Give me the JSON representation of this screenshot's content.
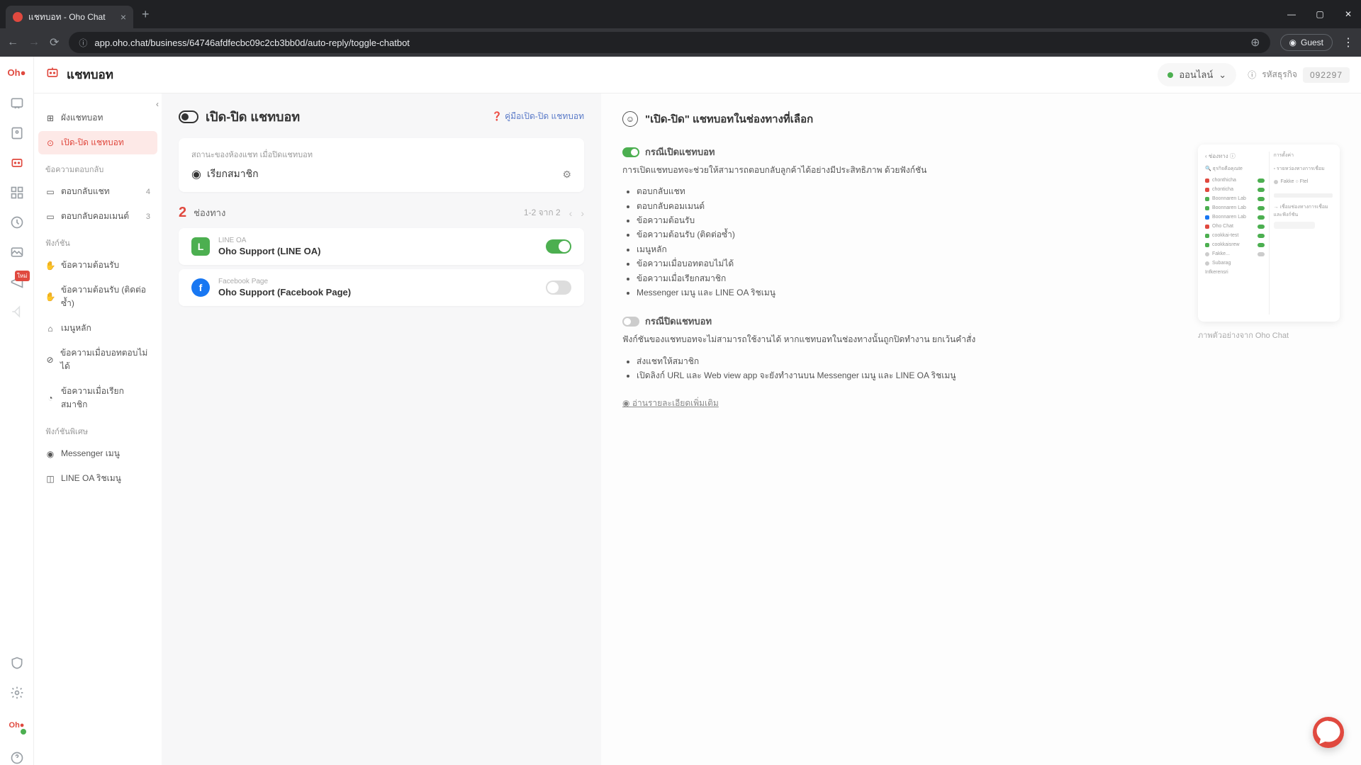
{
  "browser": {
    "tab_title": "แชทบอท - Oho Chat",
    "url": "app.oho.chat/business/64746afdfecbc09c2cb3bb0d/auto-reply/toggle-chatbot",
    "guest_label": "Guest"
  },
  "header": {
    "title": "แชทบอท",
    "status_label": "ออนไลน์",
    "biz_id_label": "รหัสธุรกิจ",
    "biz_id_value": "092297"
  },
  "sidebar": {
    "items_top": [
      {
        "label": "ผังแชทบอท",
        "icon": "flow"
      }
    ],
    "active": {
      "label": "เปิด-ปิด แชทบอท",
      "icon": "toggle"
    },
    "section_auto_reply": "ข้อความตอบกลับ",
    "items_auto": [
      {
        "label": "ตอบกลับแชท",
        "badge": "4"
      },
      {
        "label": "ตอบกลับคอมเมนต์",
        "badge": "3"
      }
    ],
    "section_func": "ฟังก์ชัน",
    "items_func": [
      {
        "label": "ข้อความต้อนรับ"
      },
      {
        "label": "ข้อความต้อนรับ (ติดต่อซ้ำ)"
      },
      {
        "label": "เมนูหลัก"
      },
      {
        "label": "ข้อความเมื่อบอทตอบไม่ได้"
      },
      {
        "label": "ข้อความเมื่อเรียกสมาชิก"
      }
    ],
    "section_special": "ฟังก์ชันพิเศษ",
    "items_special": [
      {
        "label": "Messenger เมนู"
      },
      {
        "label": "LINE OA ริชเมนู"
      }
    ]
  },
  "main": {
    "page_title": "เปิด-ปิด แชทบอท",
    "manual_link": "คู่มือเปิด-ปิด แชทบอท",
    "status_card_label": "สถานะของห้องแชท เมื่อปิดแชทบอท",
    "status_card_value": "เรียกสมาชิก",
    "channels_count": "2",
    "channels_label": "ช่องทาง",
    "pagination_text": "1-2 จาก 2",
    "channels": [
      {
        "type": "LINE OA",
        "name": "Oho Support (LINE OA)",
        "platform": "line",
        "on": true
      },
      {
        "type": "Facebook Page",
        "name": "Oho Support (Facebook Page)",
        "platform": "fb",
        "on": false
      }
    ]
  },
  "info": {
    "title": "\"เปิด-ปิด\" แชทบอทในช่องทางที่เลือก",
    "on_title": "กรณีเปิดแชทบอท",
    "on_desc": "การเปิดแชทบอทจะช่วยให้สามารถตอบกลับลูกค้าได้อย่างมีประสิทธิภาพ ด้วยฟังก์ชัน",
    "on_list": [
      "ตอบกลับแชท",
      "ตอบกลับคอมเมนต์",
      "ข้อความต้อนรับ",
      "ข้อความต้อนรับ (ติดต่อซ้ำ)",
      "เมนูหลัก",
      "ข้อความเมื่อบอทตอบไม่ได้",
      "ข้อความเมื่อเรียกสมาชิก",
      "Messenger เมนู และ LINE OA ริชเมนู"
    ],
    "off_title": "กรณีปิดแชทบอท",
    "off_desc": "ฟังก์ชันของแชทบอทจะไม่สามารถใช้งานได้ หากแชทบอทในช่องทางนั้นถูกปิดทำงาน ยกเว้นคำสั่ง",
    "off_list": [
      "ส่งแชทให้สมาชิก",
      "เปิดลิงก์ URL และ Web view app จะยังทำงานบน Messenger เมนู และ LINE OA ริชเมนู"
    ],
    "more_link": "อ่านรายละเอียดเพิ่มเติม",
    "preview_caption": "ภาพตัวอย่างจาก Oho Chat"
  }
}
